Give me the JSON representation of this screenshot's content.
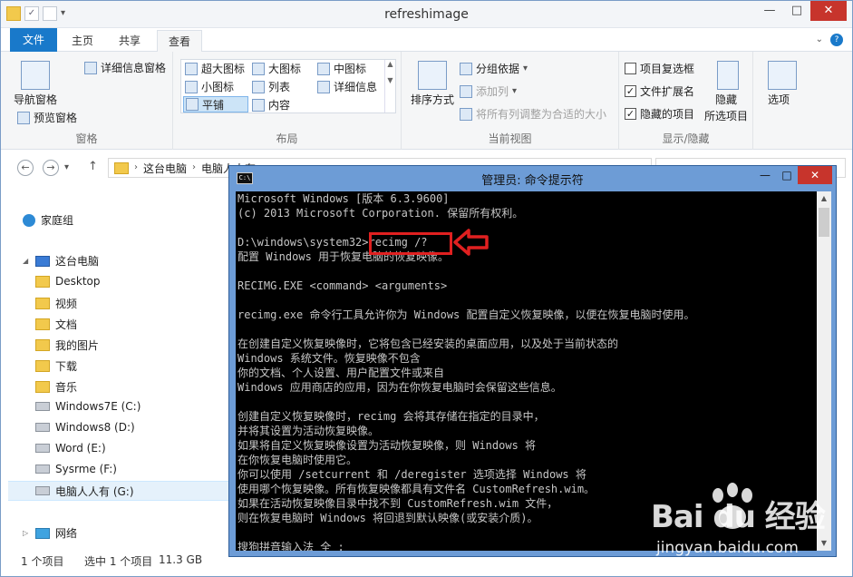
{
  "explorer": {
    "title": "refreshimage",
    "tabs": {
      "file": "文件",
      "home": "主页",
      "share": "共享",
      "view": "查看"
    },
    "ribbon": {
      "panes": {
        "nav_pane": "导航窗格",
        "preview": "预览窗格",
        "details": "详细信息窗格",
        "label": "窗格"
      },
      "layout": {
        "xlarge": "超大图标",
        "large": "大图标",
        "medium": "中图标",
        "small": "小图标",
        "list": "列表",
        "details": "详细信息",
        "tiles": "平铺",
        "content": "内容",
        "label": "布局"
      },
      "current_view": {
        "sort": "排序方式",
        "group": "分组依据",
        "add_col": "添加列",
        "fit_cols": "将所有列调整为合适的大小",
        "label": "当前视图"
      },
      "show_hide": {
        "item_checkbox": "项目复选框",
        "extensions": "文件扩展名",
        "hidden_items": "隐藏的项目",
        "hide": "隐藏",
        "hide_selected": "所选项目",
        "options": "选项",
        "label": "显示/隐藏",
        "item_checkbox_checked": false,
        "extensions_checked": true,
        "hidden_items_checked": true
      }
    },
    "address": {
      "this_pc": "这台电脑",
      "partial": "电脑人人有"
    },
    "nav": {
      "homegroup": "家庭组",
      "this_pc": "这台电脑",
      "folders": [
        "Desktop",
        "视频",
        "文档",
        "我的图片",
        "下载",
        "音乐"
      ],
      "drives": [
        "Windows7E (C:)",
        "Windows8 (D:)",
        "Word (E:)",
        "Sysrme (F:)",
        "电脑人人有 (G:)"
      ],
      "network": "网络"
    },
    "status": {
      "count": "1 个项目",
      "selected": "选中 1 个项目",
      "size": "11.3 GB"
    }
  },
  "cmd": {
    "title": "管理员: 命令提示符",
    "lines": [
      "Microsoft Windows [版本 6.3.9600]",
      "(c) 2013 Microsoft Corporation. 保留所有权利。",
      "",
      "D:\\windows\\system32>recimg /?",
      "配置 Windows 用于恢复电脑的恢复映像。",
      "",
      "RECIMG.EXE <command> <arguments>",
      "",
      "recimg.exe 命令行工具允许你为 Windows 配置自定义恢复映像，以便在恢复电脑时使用。",
      "",
      "在创建自定义恢复映像时，它将包含已经安装的桌面应用，以及处于当前状态的",
      "Windows 系统文件。恢复映像不包含",
      "你的文档、个人设置、用户配置文件或来自",
      "Windows 应用商店的应用，因为在你恢复电脑时会保留这些信息。",
      "",
      "创建自定义恢复映像时，recimg 会将其存储在指定的目录中，",
      "并将其设置为活动恢复映像。",
      "如果将自定义恢复映像设置为活动恢复映像，则 Windows 将",
      "在你恢复电脑时使用它。",
      "你可以使用 /setcurrent 和 /deregister 选项选择 Windows 将",
      "使用哪个恢复映像。所有恢复映像都具有文件名 CustomRefresh.wim。",
      "如果在活动恢复映像目录中找不到 CustomRefresh.wim 文件，",
      "则在恢复电脑时 Windows 将回退到默认映像(或安装介质)。",
      "",
      "搜狗拼音输入法 全 :"
    ]
  },
  "watermark": {
    "logo": "Bai du 经验",
    "url": "jingyan.baidu.com"
  },
  "colors": {
    "accent": "#1979ca",
    "highlight": "#e02020",
    "console_bg": "#000000",
    "console_fg": "#c6c6c6"
  }
}
